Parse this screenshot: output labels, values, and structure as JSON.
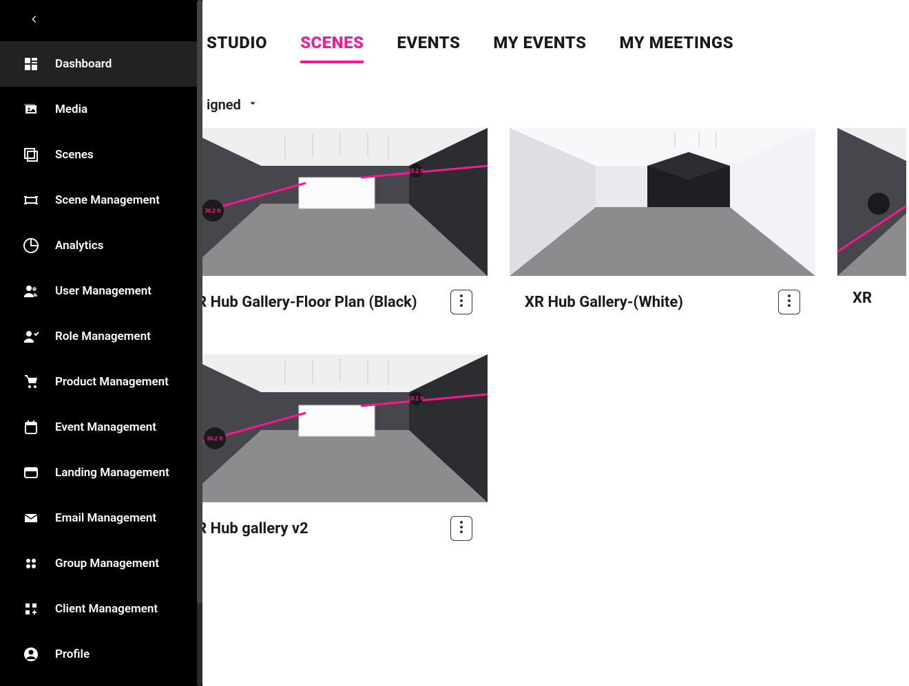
{
  "sidebar": {
    "items": [
      {
        "label": "Dashboard",
        "icon": "dashboard-icon",
        "active": true
      },
      {
        "label": "Media",
        "icon": "media-icon"
      },
      {
        "label": "Scenes",
        "icon": "scenes-icon"
      },
      {
        "label": "Scene Management",
        "icon": "scene-mgmt-icon"
      },
      {
        "label": "Analytics",
        "icon": "analytics-icon"
      },
      {
        "label": "User Management",
        "icon": "user-mgmt-icon"
      },
      {
        "label": "Role Management",
        "icon": "role-mgmt-icon"
      },
      {
        "label": "Product Management",
        "icon": "product-mgmt-icon"
      },
      {
        "label": "Event Management",
        "icon": "event-mgmt-icon"
      },
      {
        "label": "Landing Management",
        "icon": "landing-mgmt-icon"
      },
      {
        "label": "Email Management",
        "icon": "email-mgmt-icon"
      },
      {
        "label": "Group Management",
        "icon": "group-mgmt-icon"
      },
      {
        "label": "Client Management",
        "icon": "client-mgmt-icon"
      },
      {
        "label": "Profile",
        "icon": "profile-icon"
      }
    ]
  },
  "tabs": {
    "items": [
      "STUDIO",
      "SCENES",
      "EVENTS",
      "MY EVENTS",
      "MY MEETINGS"
    ],
    "active_index": 1
  },
  "filter": {
    "label_fragment": "igned"
  },
  "cards": {
    "row1": [
      {
        "title": "R Hub Gallery-Floor Plan (Black)",
        "thumb": "dark"
      },
      {
        "title": "XR Hub Gallery-(White)",
        "thumb": "white"
      },
      {
        "title": "XR",
        "thumb": "dark",
        "partial": true
      }
    ],
    "row2": [
      {
        "title": "R Hub gallery v2",
        "thumb": "dark"
      }
    ]
  },
  "scene_labels": {
    "measure_1": "36.2 ft",
    "measure_2": "18.2 ft"
  }
}
